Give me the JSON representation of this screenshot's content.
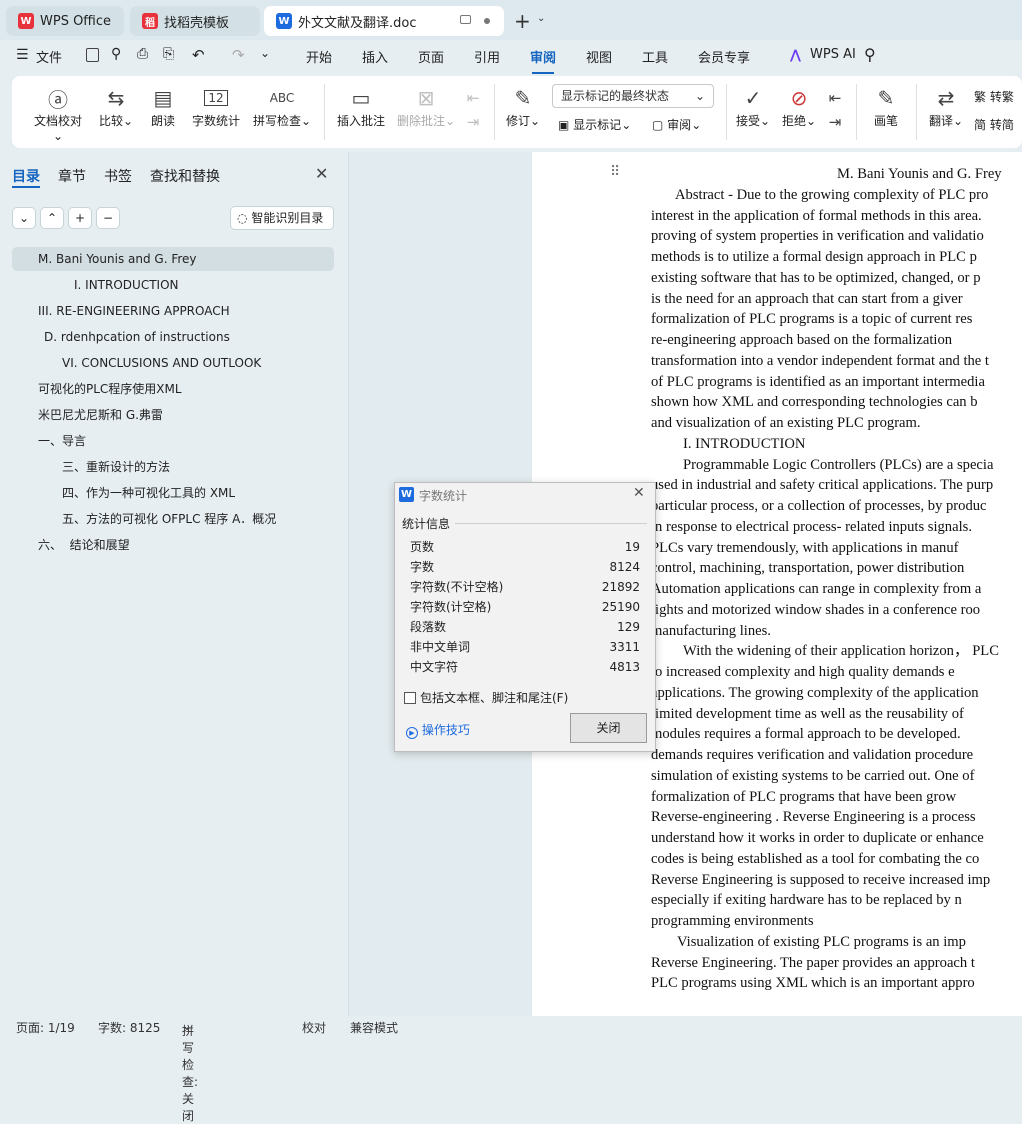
{
  "tabs": [
    {
      "label": "WPS Office"
    },
    {
      "label": "找稻壳模板"
    },
    {
      "label": "外文文献及翻译.doc"
    }
  ],
  "menu": [
    "文件",
    "开始",
    "插入",
    "页面",
    "引用",
    "审阅",
    "视图",
    "工具",
    "会员专享",
    "WPS AI"
  ],
  "toolbar": {
    "doc_check": "文档校对",
    "compare": "比较",
    "read_aloud": "朗读",
    "word_count": "字数统计",
    "spell_check": "拼写检查",
    "insert_comment": "插入批注",
    "delete_comment": "删除批注",
    "revise": "修订",
    "markup_select": "显示标记的最终状态",
    "show_markup": "显示标记",
    "review": "审阅",
    "accept": "接受",
    "reject": "拒绝",
    "pen": "画笔",
    "translate": "翻译",
    "to_simplified": "转繁",
    "to_traditional": "转简",
    "abc": "ABC",
    "num12": "12"
  },
  "sidebar": {
    "tabs": [
      "目录",
      "章节",
      "书签",
      "查找和替换"
    ],
    "smart_toc": "智能识别目录",
    "toc": [
      "M. Bani Younis and G. Frey",
      "I. INTRODUCTION",
      "III. RE-ENGINEERING APPROACH",
      "D. rdenhpcation of instructions",
      "VI. CONCLUSIONS AND OUTLOOK",
      "可视化的PLC程序使用XML",
      "米巴尼尤尼斯和 G.弗雷",
      "一、导言",
      "三、重新设计的方法",
      "四、作为一种可视化工具的 XML",
      "五、方法的可视化 OFPLC 程序 A．概况",
      "六、  结论和展望"
    ]
  },
  "document": {
    "lines": [
      "M. Bani Younis and G. Frey",
      "Abstract - Due to the growing complexity of PLC pro",
      "interest in the application of formal methods in this area.",
      "proving of system properties in verification and validatio",
      "methods is to utilize a formal design approach in PLC p",
      "existing software that has to be optimized, changed, or p",
      "is the need for an approach that can start from a giver",
      "formalization of PLC programs is a topic of current res",
      "re-engineering approach based on the formalization",
      "transformation into a vendor independent format and the t",
      "of PLC programs is identified as an important intermedia",
      "shown how XML and corresponding technologies can b",
      "and visualization of an existing PLC program.",
      "I. INTRODUCTION",
      "Programmable Logic Controllers (PLCs) are a specia",
      "used in industrial and safety critical applications. The purp",
      "particular process, or a collection of processes, by produc",
      "in response to electrical process- related inputs signals.",
      "PLCs vary tremendously, with applications in manuf",
      "control, machining, transportation, power distribution",
      "Automation applications can range in complexity from a",
      "lights and motorized window shades in a conference roo",
      "manufacturing lines.",
      "With the widening of their application horizon，  PLC",
      "to increased complexity and high quality demands e",
      "applications. The growing complexity of the application",
      "limited development time as well as the reusability of",
      "modules requires a formal approach to be developed.",
      "demands requires verification and validation procedure",
      "simulation of existing systems to be carried out. One of",
      "formalization of PLC programs that have been grow",
      "Reverse-engineering . Reverse Engineering is a process",
      "understand how it works in order to duplicate or enhance",
      "codes is being established as a tool for combating the co",
      "Reverse Engineering is supposed to receive increased imp",
      "especially if exiting hardware has to be replaced by n",
      "programming environments",
      "Visualization of existing PLC programs is an imp",
      "Reverse Engineering. The paper provides an approach t",
      "PLC programs using XML which is an important appro"
    ]
  },
  "dialog": {
    "title": "字数统计",
    "section": "统计信息",
    "rows": [
      {
        "label": "页数",
        "value": "19"
      },
      {
        "label": "字数",
        "value": "8124"
      },
      {
        "label": "字符数(不计空格)",
        "value": "21892"
      },
      {
        "label": "字符数(计空格)",
        "value": "25190"
      },
      {
        "label": "段落数",
        "value": "129"
      },
      {
        "label": "非中文单词",
        "value": "3311"
      },
      {
        "label": "中文字符",
        "value": "4813"
      }
    ],
    "checkbox_label": "包括文本框、脚注和尾注(F)",
    "tips": "操作技巧",
    "close": "关闭"
  },
  "status": {
    "page": "页面: 1/19",
    "words": "字数: 8125",
    "spell": "拼写检查: 关闭",
    "proof": "校对",
    "compat": "兼容模式"
  },
  "colors": {
    "accent": "#1565c0",
    "wps_red": "#e8323c"
  }
}
